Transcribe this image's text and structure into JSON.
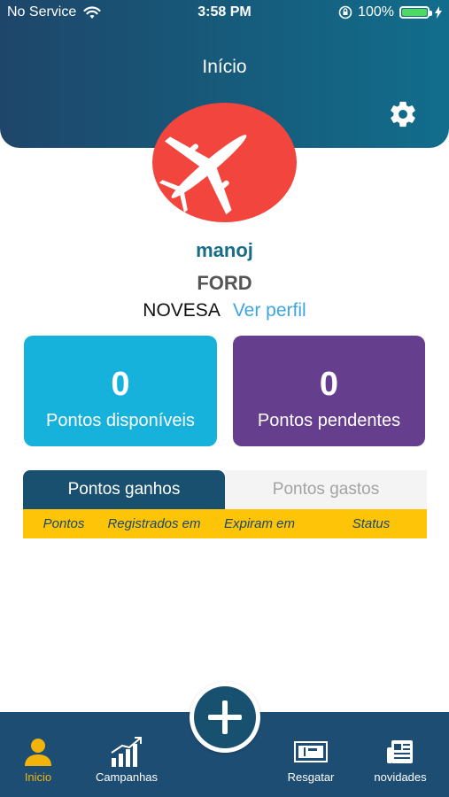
{
  "status_bar": {
    "carrier": "No Service",
    "time": "3:58 PM",
    "battery_percent": "100%",
    "battery_level": 1.0
  },
  "header": {
    "title": "Início",
    "background_color": "#1e466a"
  },
  "profile": {
    "avatar_bg": "#f2453d",
    "name": "manoj",
    "company": "FORD",
    "dealer": "NOVESA",
    "ver_perfil": "Ver perfil"
  },
  "cards": [
    {
      "value": "0",
      "label": "Pontos disponíveis",
      "color": "#16b2db"
    },
    {
      "value": "0",
      "label": "Pontos pendentes",
      "color": "#663e8e"
    }
  ],
  "tabs": [
    {
      "label": "Pontos ganhos",
      "active": true
    },
    {
      "label": "Pontos gastos",
      "active": false
    }
  ],
  "table": {
    "columns": [
      "Pontos",
      "Registrados em",
      "Expiram em",
      "Status"
    ],
    "header_color": "#fdc408"
  },
  "bottom_nav": {
    "items": [
      {
        "label": "Inicio",
        "icon": "user-icon",
        "active": true
      },
      {
        "label": "Campanhas",
        "icon": "chart-icon",
        "active": false
      },
      {
        "label": "Resgatar",
        "icon": "voucher-icon",
        "active": false
      },
      {
        "label": "novidades",
        "icon": "news-icon",
        "active": false
      }
    ],
    "fab_icon": "plus-icon",
    "active_color": "#f2b40a"
  }
}
